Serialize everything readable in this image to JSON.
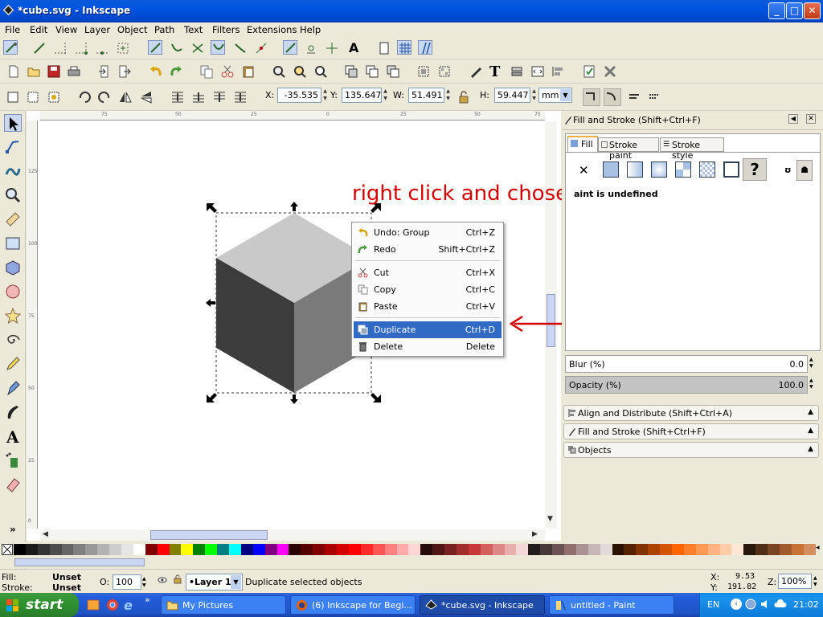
{
  "window": {
    "title": "*cube.svg - Inkscape"
  },
  "menu": [
    "File",
    "Edit",
    "View",
    "Layer",
    "Object",
    "Path",
    "Text",
    "Filters",
    "Extensions",
    "Help"
  ],
  "controls": {
    "x_label": "X:",
    "x_value": "-35.535",
    "y_label": "Y:",
    "y_value": "135.647",
    "w_label": "W:",
    "w_value": "51.491",
    "h_label": "H:",
    "h_value": "59.447",
    "unit": "mm"
  },
  "ruler_top_ticks": [
    "75",
    "50",
    "25",
    "0",
    "25",
    "50",
    "75"
  ],
  "ruler_left_ticks": [
    "125",
    "100",
    "75",
    "50",
    "25",
    "0"
  ],
  "annotation": "right click and chose",
  "context_menu": {
    "items": [
      {
        "label": "Undo: Group",
        "shortcut": "Ctrl+Z",
        "icon": "undo-icon"
      },
      {
        "label": "Redo",
        "shortcut": "Shift+Ctrl+Z",
        "icon": "redo-icon"
      },
      {
        "label": "Cut",
        "shortcut": "Ctrl+X",
        "icon": "cut-icon"
      },
      {
        "label": "Copy",
        "shortcut": "Ctrl+C",
        "icon": "copy-icon"
      },
      {
        "label": "Paste",
        "shortcut": "Ctrl+V",
        "icon": "paste-icon"
      },
      {
        "label": "Duplicate",
        "shortcut": "Ctrl+D",
        "icon": "duplicate-icon",
        "selected": true
      },
      {
        "label": "Delete",
        "shortcut": "Delete",
        "icon": "delete-icon"
      }
    ]
  },
  "fill_stroke": {
    "title": "Fill and Stroke (Shift+Ctrl+F)",
    "tabs": [
      "Fill",
      "Stroke paint",
      "Stroke style"
    ],
    "paint_status": "aint is undefined",
    "blur_label": "Blur (%)",
    "blur_value": "0.0",
    "opacity_label": "Opacity (%)",
    "opacity_value": "100.0"
  },
  "docks": [
    "Align and Distribute (Shift+Ctrl+A)",
    "Fill and Stroke (Shift+Ctrl+F)",
    "Objects"
  ],
  "status": {
    "fill_label": "Fill:",
    "fill_value": "Unset",
    "stroke_label": "Stroke:",
    "stroke_value": "Unset",
    "opacity_label": "O:",
    "opacity_value": "100",
    "layer": "•Layer 1",
    "message": "Duplicate selected objects",
    "x_label": "X:",
    "x_value": "9.53",
    "y_label": "Y:",
    "y_value": "191.82",
    "zoom_label": "Z:",
    "zoom_value": "100%"
  },
  "taskbar": {
    "start": "start",
    "tasks": [
      "My Pictures",
      "(6) Inkscape for Begi...",
      "*cube.svg - Inkscape",
      "untitled - Paint"
    ],
    "lang": "EN",
    "clock": "21:02"
  },
  "colors": {
    "accent": "#316ac5",
    "annotation": "#d40000",
    "cube_top": "#c9c9c9",
    "cube_left": "#3c3c3c",
    "cube_right": "#7a7a7a"
  },
  "palette": [
    "#000000",
    "#1a1a1a",
    "#333333",
    "#4d4d4d",
    "#666666",
    "#808080",
    "#999999",
    "#b3b3b3",
    "#cccccc",
    "#e6e6e6",
    "#ffffff",
    "#800000",
    "#ff0000",
    "#808000",
    "#ffff00",
    "#008000",
    "#00ff00",
    "#008080",
    "#00ffff",
    "#000080",
    "#0000ff",
    "#800080",
    "#ff00ff",
    "#2b0000",
    "#550000",
    "#800000",
    "#aa0000",
    "#d40000",
    "#ff0000",
    "#ff2a2a",
    "#ff5555",
    "#ff8080",
    "#ffaaaa",
    "#ffd5d5",
    "#280b0b",
    "#501616",
    "#782121",
    "#a02c2c",
    "#c83737",
    "#d35f5f",
    "#de8787",
    "#e9afaf",
    "#f4d7d7",
    "#241c1c",
    "#483737",
    "#6c5353",
    "#916f6f",
    "#ac9393",
    "#c8b7b7",
    "#e3dbdb",
    "#2b1100",
    "#552200",
    "#803300",
    "#aa4400",
    "#d45500",
    "#ff6600",
    "#ff7f2a",
    "#ff9955",
    "#ffb380",
    "#ffccaa",
    "#ffe6d5",
    "#28170b",
    "#502d16",
    "#784421",
    "#a05a2c",
    "#c87137",
    "#d38d5f"
  ]
}
